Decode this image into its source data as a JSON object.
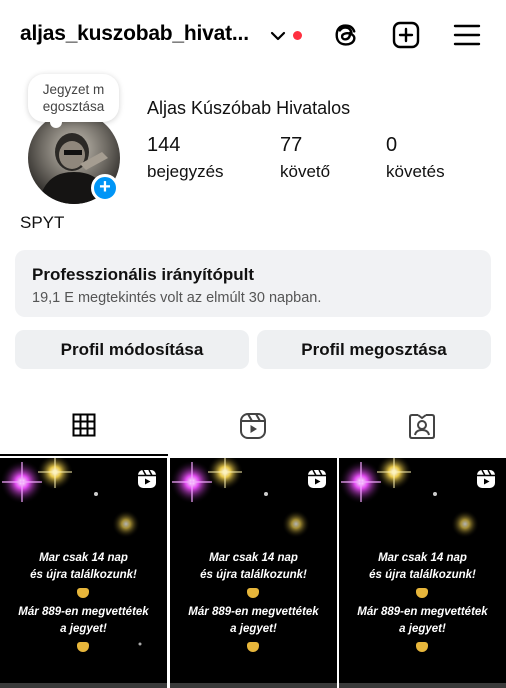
{
  "header": {
    "username": "aljas_kuszobab_hivat...",
    "icons": [
      "chevron-down-icon",
      "threads-icon",
      "add-post-icon",
      "menu-icon"
    ],
    "notification_dot_color": "#ff3040"
  },
  "profile": {
    "note": "Jegyzet m egosztása",
    "full_name": "Aljas Kúszóbab Hivatalos",
    "bio_name": "SPYT",
    "stats": [
      {
        "value": "144",
        "label": "bejegyzés"
      },
      {
        "value": "77",
        "label": "követő"
      },
      {
        "value": "0",
        "label": "követés"
      }
    ],
    "add_badge": "+"
  },
  "dashboard": {
    "title": "Professzionális irányítópult",
    "subtitle": "19,1 E megtekintés volt az elmúlt 30 napban."
  },
  "buttons": {
    "edit": "Profil módosítása",
    "share": "Profil megosztása"
  },
  "tabs": [
    {
      "icon": "grid-icon",
      "active": true
    },
    {
      "icon": "reels-icon",
      "active": false
    },
    {
      "icon": "tagged-icon",
      "active": false
    }
  ],
  "posts": [
    {
      "line1": "Mar csak 14 nap",
      "line2": "és újra találkozunk!",
      "line3": "Már 889-en megvettétek",
      "line4": "a jegyet!"
    },
    {
      "line1": "Mar csak 14 nap",
      "line2": "és újra találkozunk!",
      "line3": "Már 889-en megvettétek",
      "line4": "a jegyet!"
    },
    {
      "line1": "Mar csak 14 nap",
      "line2": "és újra találkozunk!",
      "line3": "Már 889-en megvettétek",
      "line4": "a jegyet!"
    }
  ],
  "colors": {
    "accent": "#0095f6",
    "button_bg": "#eef0f2",
    "dashboard_bg": "#f1f2f4"
  }
}
